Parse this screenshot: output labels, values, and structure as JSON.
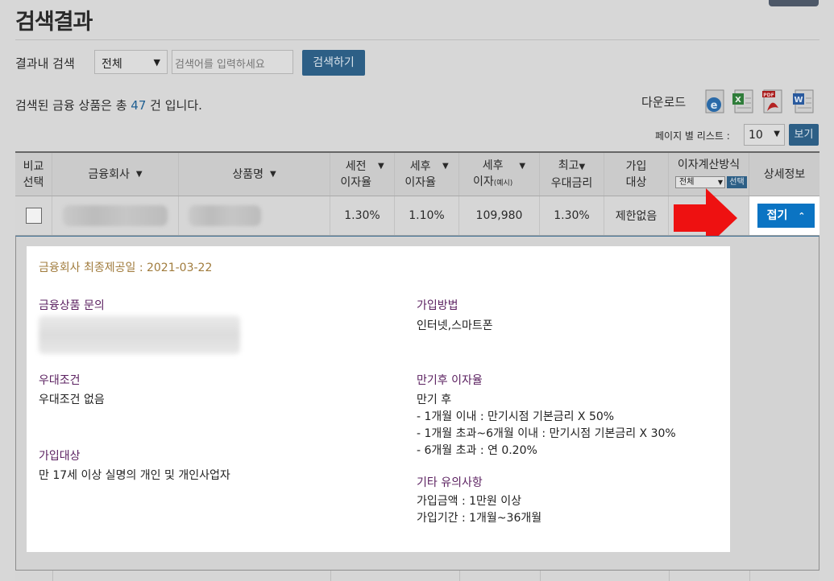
{
  "page_title": "검색결과",
  "search": {
    "label": "결과내 검색",
    "scope_value": "전체",
    "placeholder": "검색어를 입력하세요",
    "button": "검색하기"
  },
  "summary": {
    "prefix": "검색된 금융 상품은 총",
    "count": "47",
    "suffix": "건 입니다."
  },
  "download": {
    "label": "다운로드",
    "formats": [
      "ie-icon",
      "excel-icon",
      "pdf-icon",
      "word-icon"
    ]
  },
  "pagination": {
    "per_page_label": "페이지 별 리스트 :",
    "per_page_value": "10",
    "view_button": "보기"
  },
  "table": {
    "headers": {
      "compare_line1": "비교",
      "compare_line2": "선택",
      "company": "금융회사",
      "product": "상품명",
      "pretax_line1": "세전",
      "pretax_line2": "이자율",
      "aftertax_line1": "세후",
      "aftertax_line2": "이자율",
      "interest_line1": "세후",
      "interest_line2": "이자",
      "interest_note": "(예시)",
      "max_line1": "최고",
      "max_line2": "우대금리",
      "target_line1": "가입",
      "target_line2": "대상",
      "calc": "이자계산방식",
      "calc_select": "전체",
      "calc_button": "선택",
      "detail": "상세정보"
    },
    "row": {
      "pretax_rate": "1.30%",
      "aftertax_rate": "1.10%",
      "aftertax_interest": "109,980",
      "max_rate": "1.30%",
      "target": "제한없음",
      "fold_button": "접기"
    }
  },
  "detail": {
    "provided_date": "금융회사 최종제공일 : 2021-03-22",
    "inquiry_title": "금융상품 문의",
    "join_method_title": "가입방법",
    "join_method": "인터넷,스마트폰",
    "preferential_title": "우대조건",
    "preferential": "우대조건 없음",
    "maturity_title": "만기후 이자율",
    "maturity_lines": [
      "만기 후",
      "- 1개월 이내 : 만기시점 기본금리 X 50%",
      "- 1개월 초과~6개월 이내 : 만기시점 기본금리 X 30%",
      "- 6개월 초과 : 연 0.20%"
    ],
    "target_title": "가입대상",
    "target": "만 17세 이상 실명의 개인 및 개인사업자",
    "notes_title": "기타 유의사항",
    "notes_lines": [
      "가입금액 : 1만원 이상",
      "가입기간 : 1개월~36개월"
    ]
  },
  "colors": {
    "button_blue": "#0b74c3",
    "arrow_red": "#ee1111",
    "date_gold": "#a07b3c",
    "section_purple": "#5a1f5f"
  }
}
